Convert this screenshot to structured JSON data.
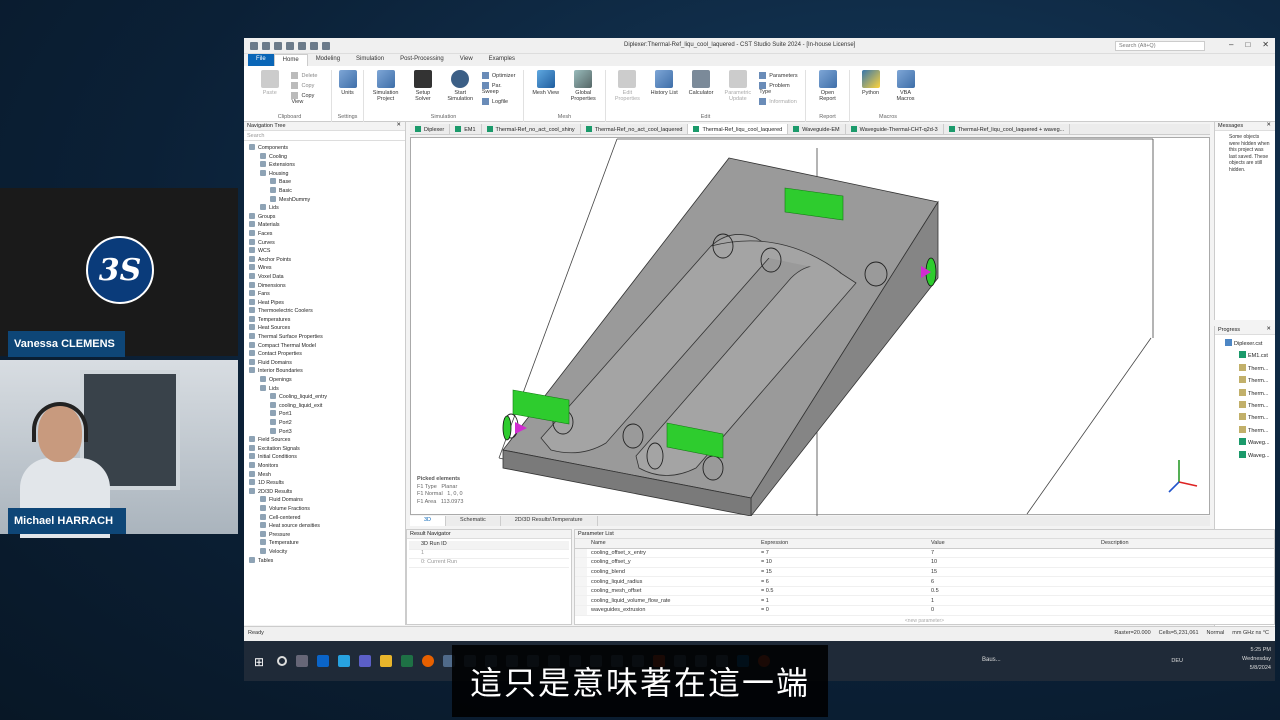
{
  "app": {
    "title": "Diplexer:Thermal-Ref_liqu_cool_laquered - CST Studio Suite 2024 - [In-house License]",
    "search_placeholder": "Search (Alt+Q)",
    "menu_tabs": [
      "File",
      "Home",
      "Modeling",
      "Simulation",
      "Post-Processing",
      "View",
      "Examples"
    ],
    "active_tab": "Home"
  },
  "ribbon": {
    "clipboard": {
      "label": "Clipboard",
      "paste": "Paste",
      "delete": "Delete",
      "copy": "Copy",
      "copy_view": "Copy View"
    },
    "settings": {
      "label": "Settings",
      "units": "Units"
    },
    "simulation": {
      "label": "Simulation",
      "sim_project": "Simulation Project",
      "setup_solver": "Setup Solver",
      "start_sim": "Start Simulation",
      "optimizer": "Optimizer",
      "par_sweep": "Par. Sweep",
      "logfile": "Logfile"
    },
    "mesh": {
      "label": "Mesh",
      "mesh_view": "Mesh View",
      "global_props": "Global Properties"
    },
    "edit": {
      "label": "Edit",
      "edit_props": "Edit Properties",
      "history": "History List",
      "calculator": "Calculator",
      "param_update": "Parametric Update",
      "parameters": "Parameters",
      "problem_type": "Problem Type",
      "information": "Information"
    },
    "report": {
      "label": "Report",
      "open_report": "Open Report"
    },
    "macros": {
      "label": "Macros",
      "python": "Python",
      "vba": "VBA Macros"
    }
  },
  "nav_tree": {
    "title": "Navigation Tree",
    "search": "Search",
    "items": [
      {
        "label": "Components",
        "level": 0
      },
      {
        "label": "Cooling",
        "level": 1
      },
      {
        "label": "Extensions",
        "level": 1
      },
      {
        "label": "Housing",
        "level": 1
      },
      {
        "label": "Base",
        "level": 2
      },
      {
        "label": "Basic",
        "level": 2
      },
      {
        "label": "MeshDummy",
        "level": 2
      },
      {
        "label": "Lids",
        "level": 1
      },
      {
        "label": "Groups",
        "level": 0
      },
      {
        "label": "Materials",
        "level": 0
      },
      {
        "label": "Faces",
        "level": 0
      },
      {
        "label": "Curves",
        "level": 0
      },
      {
        "label": "WCS",
        "level": 0
      },
      {
        "label": "Anchor Points",
        "level": 0
      },
      {
        "label": "Wires",
        "level": 0
      },
      {
        "label": "Voxel Data",
        "level": 0
      },
      {
        "label": "Dimensions",
        "level": 0
      },
      {
        "label": "Fans",
        "level": 0
      },
      {
        "label": "Heat Pipes",
        "level": 0
      },
      {
        "label": "Thermoelectric Coolers",
        "level": 0
      },
      {
        "label": "Temperatures",
        "level": 0
      },
      {
        "label": "Heat Sources",
        "level": 0
      },
      {
        "label": "Thermal Surface Properties",
        "level": 0
      },
      {
        "label": "Compact Thermal Model",
        "level": 0
      },
      {
        "label": "Contact Properties",
        "level": 0
      },
      {
        "label": "Fluid Domains",
        "level": 0
      },
      {
        "label": "Interior Boundaries",
        "level": 0
      },
      {
        "label": "Openings",
        "level": 1
      },
      {
        "label": "Lids",
        "level": 1
      },
      {
        "label": "Cooling_liquid_entry",
        "level": 2
      },
      {
        "label": "cooling_liquid_exit",
        "level": 2
      },
      {
        "label": "Port1",
        "level": 2
      },
      {
        "label": "Port2",
        "level": 2
      },
      {
        "label": "Port3",
        "level": 2
      },
      {
        "label": "Field Sources",
        "level": 0
      },
      {
        "label": "Excitation Signals",
        "level": 0
      },
      {
        "label": "Initial Conditions",
        "level": 0
      },
      {
        "label": "Monitors",
        "level": 0
      },
      {
        "label": "Mesh",
        "level": 0
      },
      {
        "label": "1D Results",
        "level": 0
      },
      {
        "label": "2D/3D Results",
        "level": 0
      },
      {
        "label": "Fluid Domains",
        "level": 1
      },
      {
        "label": "Volume Fractions",
        "level": 1
      },
      {
        "label": "Cell-centered",
        "level": 1
      },
      {
        "label": "Heat source densities",
        "level": 1
      },
      {
        "label": "Pressure",
        "level": 1
      },
      {
        "label": "Temperature",
        "level": 1
      },
      {
        "label": "Velocity",
        "level": 1
      },
      {
        "label": "Tables",
        "level": 0
      }
    ]
  },
  "view_tabs": [
    "Diplexer",
    "EM1",
    "Thermal-Ref_no_act_cool_shiny",
    "Thermal-Ref_no_act_cool_laquered",
    "Thermal-Ref_liqu_cool_laquered",
    "Waveguide-EM",
    "Waveguide-Thermal-CHT-q2d-3",
    "Thermal-Ref_liqu_cool_laquered + waveg..."
  ],
  "active_view_tab": 4,
  "picked": {
    "title": "Picked elements",
    "type_label": "F1 Type",
    "type_val": "Planar",
    "normal_label": "F1 Normal",
    "normal_val": "1, 0, 0",
    "area_label": "F1 Area",
    "area_val": "113.0973"
  },
  "view_bottom_tabs": [
    "3D",
    "Schematic",
    "2D/3D Results\\Temperature"
  ],
  "messages": {
    "title": "Messages",
    "text": "Some objects were hidden when this project was last saved. These objects are still hidden."
  },
  "progress": {
    "title": "Progress",
    "items": [
      "Diplexer.cst",
      "EM1.cst",
      "Therm...",
      "Therm...",
      "Therm...",
      "Therm...",
      "Therm...",
      "Therm...",
      "Waveg...",
      "Waveg..."
    ]
  },
  "result_nav": {
    "title": "Result Navigator",
    "col": "3D Run ID",
    "rows": [
      "1",
      "0: Current Run"
    ]
  },
  "param_list": {
    "title": "Parameter List",
    "cols": [
      "Name",
      "Expression",
      "Value",
      "Description"
    ],
    "rows": [
      {
        "name": "cooling_offset_x_entry",
        "expr": "= 7",
        "val": "7"
      },
      {
        "name": "cooling_offset_y",
        "expr": "= 10",
        "val": "10"
      },
      {
        "name": "cooling_blend",
        "expr": "= 15",
        "val": "15"
      },
      {
        "name": "cooling_liquid_radius",
        "expr": "= 6",
        "val": "6"
      },
      {
        "name": "cooling_mesh_offset",
        "expr": "= 0.5",
        "val": "0.5"
      },
      {
        "name": "cooling_liquid_volume_flow_rate",
        "expr": "= 1",
        "val": "1"
      },
      {
        "name": "waveguides_extrusion",
        "expr": "= 0",
        "val": "0"
      }
    ],
    "new_param": "<new parameter>"
  },
  "status": {
    "left": "Ready",
    "raster": "Raster=20.000",
    "cells": "Cells=5,231,061",
    "normal": "Normal",
    "units": "mm GHz ns °C"
  },
  "taskbar": {
    "weather": "Baus...",
    "lang": "DEU",
    "time": "5:25 PM",
    "day": "Wednesday",
    "date": "5/8/2024"
  },
  "speakers": {
    "top": "Vanessa CLEMENS",
    "bottom": "Michael HARRACH",
    "logo": "3S"
  },
  "subtitle": "這只是意味著在這一端"
}
